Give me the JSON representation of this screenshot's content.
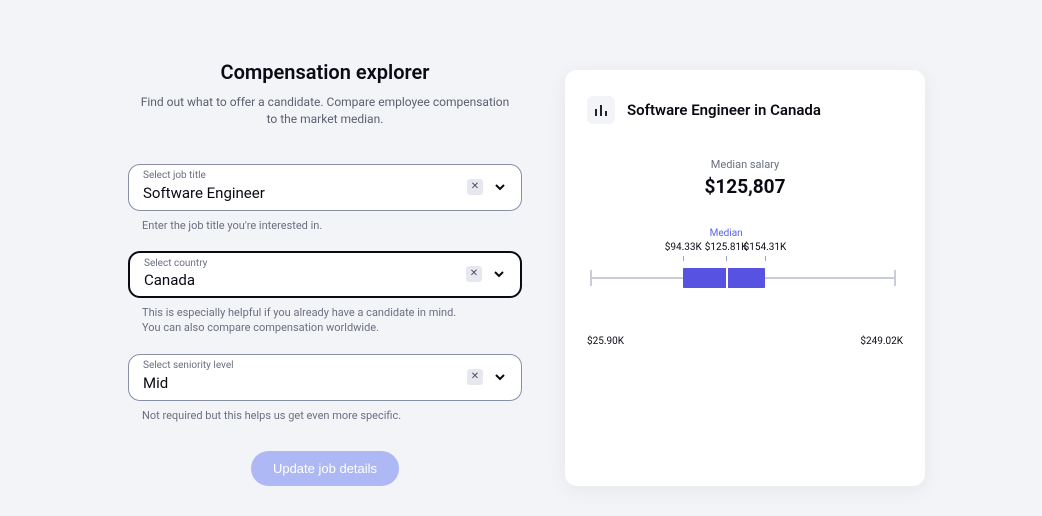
{
  "title": "Compensation explorer",
  "subtitle": "Find out what to offer a candidate. Compare employee compensation to the market median.",
  "fields": {
    "job": {
      "label": "Select job title",
      "value": "Software Engineer",
      "helper": "Enter the job title you're interested in."
    },
    "country": {
      "label": "Select country",
      "value": "Canada",
      "helper": "This is especially helpful if you already have a candidate in mind.\nYou can also compare compensation worldwide."
    },
    "seniority": {
      "label": "Select seniority level",
      "value": "Mid",
      "helper": "Not required but this helps us get even more specific."
    }
  },
  "update_button": "Update job details",
  "card": {
    "title": "Software Engineer in Canada",
    "median_label": "Median salary",
    "median_value": "$125,807"
  },
  "chart_data": {
    "type": "boxplot",
    "title": "Software Engineer in Canada",
    "unit": "USD",
    "min": 25900,
    "q1": 94330,
    "median": 125810,
    "q3": 154310,
    "max": 249020,
    "labels": {
      "min": "$25.90K",
      "q1": "$94.33K",
      "median": "$125.81K",
      "median_name": "Median",
      "q3": "$154.31K",
      "max": "$249.02K"
    }
  }
}
